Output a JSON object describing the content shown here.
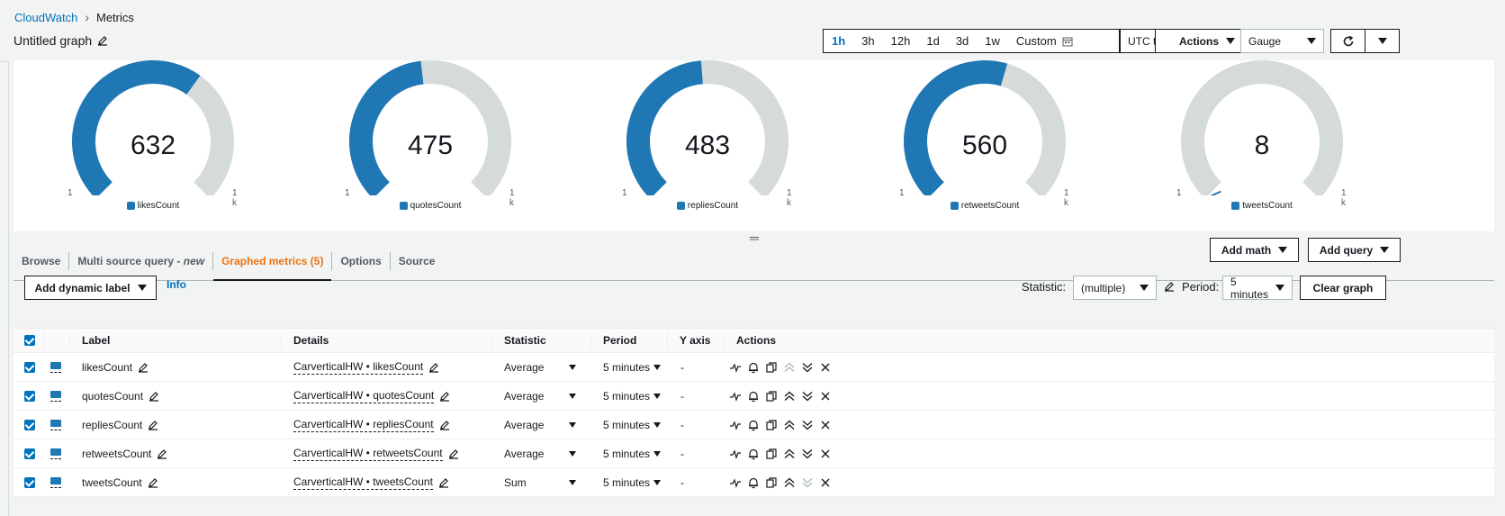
{
  "breadcrumb": {
    "root": "CloudWatch",
    "current": "Metrics"
  },
  "graph_title": "Untitled graph",
  "time_range": {
    "options": [
      "1h",
      "3h",
      "12h",
      "1d",
      "3d",
      "1w"
    ],
    "active": "1h",
    "custom_label": "Custom"
  },
  "timezone": "UTC timezone",
  "actions_label": "Actions",
  "view_type": "Gauge",
  "gauges": [
    {
      "value": "632",
      "fraction": 0.632,
      "min": "1",
      "max": "1 k",
      "legend": "likesCount"
    },
    {
      "value": "475",
      "fraction": 0.475,
      "min": "1",
      "max": "1 k",
      "legend": "quotesCount"
    },
    {
      "value": "483",
      "fraction": 0.483,
      "min": "1",
      "max": "1 k",
      "legend": "repliesCount"
    },
    {
      "value": "560",
      "fraction": 0.56,
      "min": "1",
      "max": "1 k",
      "legend": "retweetsCount"
    },
    {
      "value": "8",
      "fraction": 0.008,
      "min": "1",
      "max": "1 k",
      "legend": "tweetsCount"
    }
  ],
  "tabs": {
    "browse": "Browse",
    "multi_source": "Multi source query - ",
    "multi_source_new": "new",
    "graphed": "Graphed metrics (5)",
    "options": "Options",
    "source": "Source"
  },
  "add_math": "Add math",
  "add_query": "Add query",
  "add_dynamic_label": "Add dynamic label",
  "info": "Info",
  "statistic_label": "Statistic:",
  "statistic_value": "(multiple)",
  "period_label": "Period:",
  "period_value": "5 minutes",
  "clear_graph": "Clear graph",
  "table": {
    "headers": {
      "label": "Label",
      "details": "Details",
      "statistic": "Statistic",
      "period": "Period",
      "yaxis": "Y axis",
      "actions": "Actions"
    },
    "rows": [
      {
        "label": "likesCount",
        "details": "CarverticalHW • likesCount",
        "statistic": "Average",
        "period": "5 minutes",
        "yaxis": "-"
      },
      {
        "label": "quotesCount",
        "details": "CarverticalHW • quotesCount",
        "statistic": "Average",
        "period": "5 minutes",
        "yaxis": "-"
      },
      {
        "label": "repliesCount",
        "details": "CarverticalHW • repliesCount",
        "statistic": "Average",
        "period": "5 minutes",
        "yaxis": "-"
      },
      {
        "label": "retweetsCount",
        "details": "CarverticalHW • retweetsCount",
        "statistic": "Average",
        "period": "5 minutes",
        "yaxis": "-"
      },
      {
        "label": "tweetsCount",
        "details": "CarverticalHW • tweetsCount",
        "statistic": "Sum",
        "period": "5 minutes",
        "yaxis": "-"
      }
    ]
  },
  "colors": {
    "series": "#1f77b4",
    "track": "#d5dbdb",
    "link": "#0073bb",
    "active_tab": "#ec7211"
  }
}
